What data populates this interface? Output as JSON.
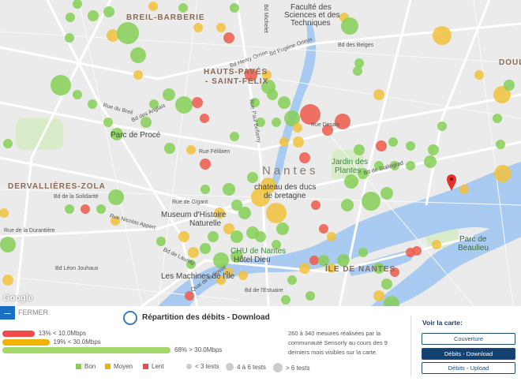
{
  "map": {
    "districts": [
      "BREIL-BARBERIE",
      "HAUTS-PAVÉS",
      "- SAINT-FÉLIX",
      "DERVALLIÈRES-ZOLA",
      "ÎLE DE NANTES",
      "DOULO"
    ],
    "city": "Nantes",
    "pois": [
      "Faculté des",
      "Sciences et des",
      "Techniques",
      "Parc de Procé",
      "chateau des ducs",
      "de bretagne",
      "Museum d'Histoire",
      "Naturelle",
      "CHU de Nantes",
      "Hôtel Dieu",
      "Les Machines de l'Île",
      "Jardin des",
      "Plantes",
      "Parc de",
      "Beaulieu"
    ],
    "streets": [
      "Rue Félibien",
      "Bd Henry Orrion",
      "Bd Eugène Orieux",
      "Bd des Belges",
      "Rue Desaix",
      "Rue de Gigant",
      "Bd Léon Jouhaux",
      "Bd de Launay",
      "Quai de la Fosse",
      "Bd de l'Estuaire",
      "Rue du Breil",
      "Bd des Anglais",
      "Bd de la Solidarité",
      "Rue de la Durantière",
      "Rue Paul Bellamy",
      "Bd Michelet",
      "Bd de Stalingrad",
      "Rue Nicolas Appert"
    ],
    "attribution": "Google",
    "colors": {
      "bon": "#86cf57",
      "moyen": "#f0c23c",
      "lent": "#ee5b4b",
      "river": "#aacbf0"
    }
  },
  "panel": {
    "close_label": "FERMER",
    "title": "Répartition des débits - Download",
    "bars": [
      {
        "label": "13% < 10.0Mbps",
        "percent": 13,
        "color": "#f04a4a"
      },
      {
        "label": "19% < 30.0Mbps",
        "percent": 19,
        "color": "#f0b400"
      },
      {
        "label": "68% > 30.0Mbps",
        "percent": 68,
        "color": "#a5d86a"
      }
    ],
    "legend": {
      "bon": "Bon",
      "moyen": "Moyen",
      "lent": "Lent",
      "small": "< 3 tests",
      "medium": "4 à 6 tests",
      "large": "> 6 tests"
    },
    "description": "260 à 340 mesures réalisées par la communauté Sensorly au cours des 9 derniers mois visibles sur la carte.",
    "voir_label": "Voir la carte:",
    "buttons": [
      "Couverture",
      "Débits - Download",
      "Débits - Upload"
    ]
  }
}
